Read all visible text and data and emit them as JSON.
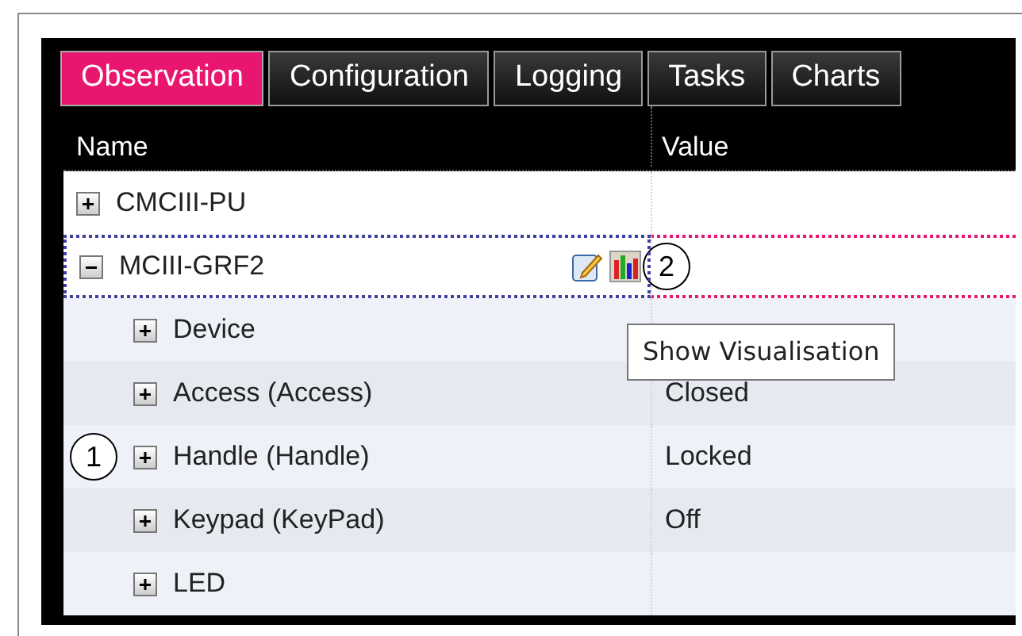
{
  "tabs": [
    {
      "label": "Observation",
      "selected": true
    },
    {
      "label": "Configuration",
      "selected": false
    },
    {
      "label": "Logging",
      "selected": false
    },
    {
      "label": "Tasks",
      "selected": false
    },
    {
      "label": "Charts",
      "selected": false
    }
  ],
  "table": {
    "columns": [
      "Name",
      "Value"
    ],
    "rows": [
      {
        "name": "CMCIII-PU",
        "expanded": false,
        "selected": false
      },
      {
        "name": "MCIII-GRF2",
        "expanded": true,
        "selected": true,
        "callout": "2",
        "children": [
          {
            "name": "Device",
            "expanded": false,
            "selected": false
          },
          {
            "name": "Access (Access)",
            "value": "Closed",
            "expanded": false,
            "selected": false
          },
          {
            "name": "Handle (Handle)",
            "value": "Locked",
            "expanded": false,
            "selected": false,
            "callout": "1"
          },
          {
            "name": "Keypad (KeyPad)",
            "value": "Off",
            "expanded": false,
            "selected": false
          },
          {
            "name": "LED",
            "expanded": false,
            "selected": false
          }
        ]
      }
    ]
  },
  "tooltip": {
    "text": "Show Visualisation"
  }
}
